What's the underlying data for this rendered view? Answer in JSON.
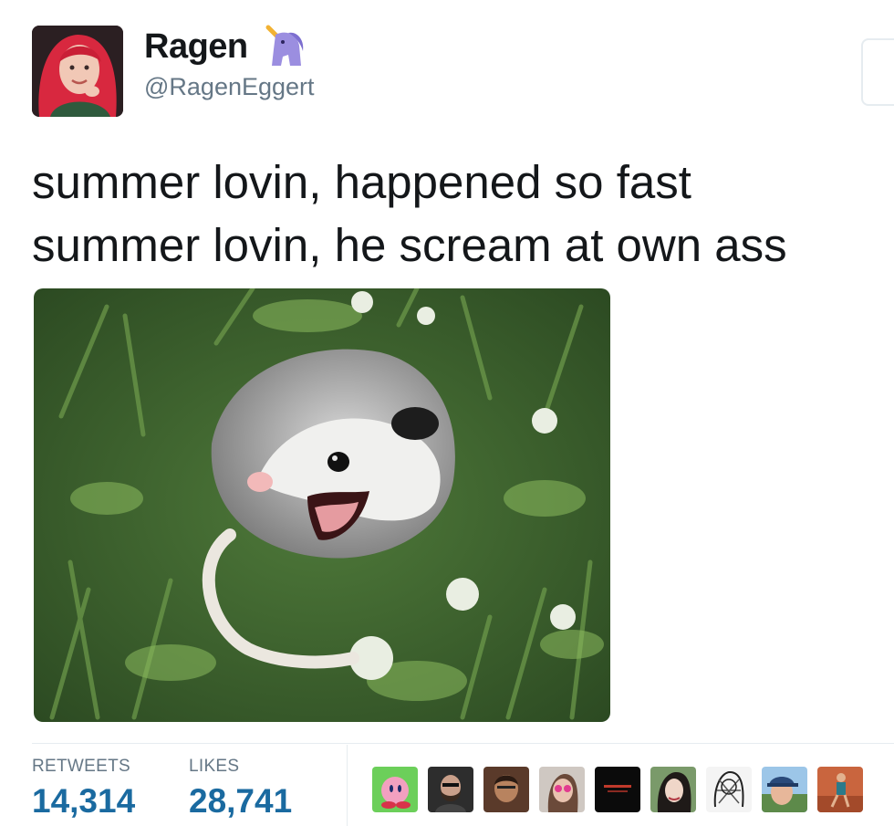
{
  "author": {
    "name": "Ragen",
    "handle": "@RagenEggert",
    "avatar_icon": "profile-photo-red-hair",
    "name_emoji": "unicorn-icon"
  },
  "tweet": {
    "text": "summer lovin, happened so fast\nsummer lovin, he scream at own ass"
  },
  "media": {
    "icon": "opossum-photo"
  },
  "stats": {
    "retweets_label": "RETWEETS",
    "retweets_value": "14,314",
    "likes_label": "LIKES",
    "likes_value": "28,741"
  },
  "likers": [
    "kirby-avatar-icon",
    "bearded-man-avatar-icon",
    "portrait-avatar-icon",
    "woman-pink-glasses-avatar-icon",
    "dark-text-avatar-icon",
    "woman-dark-hair-avatar-icon",
    "sketch-avatar-icon",
    "cap-selfie-avatar-icon",
    "running-woman-avatar-icon"
  ],
  "colors": {
    "stat_value": "#1a6aa0",
    "muted": "#657786",
    "text": "#14171a"
  }
}
